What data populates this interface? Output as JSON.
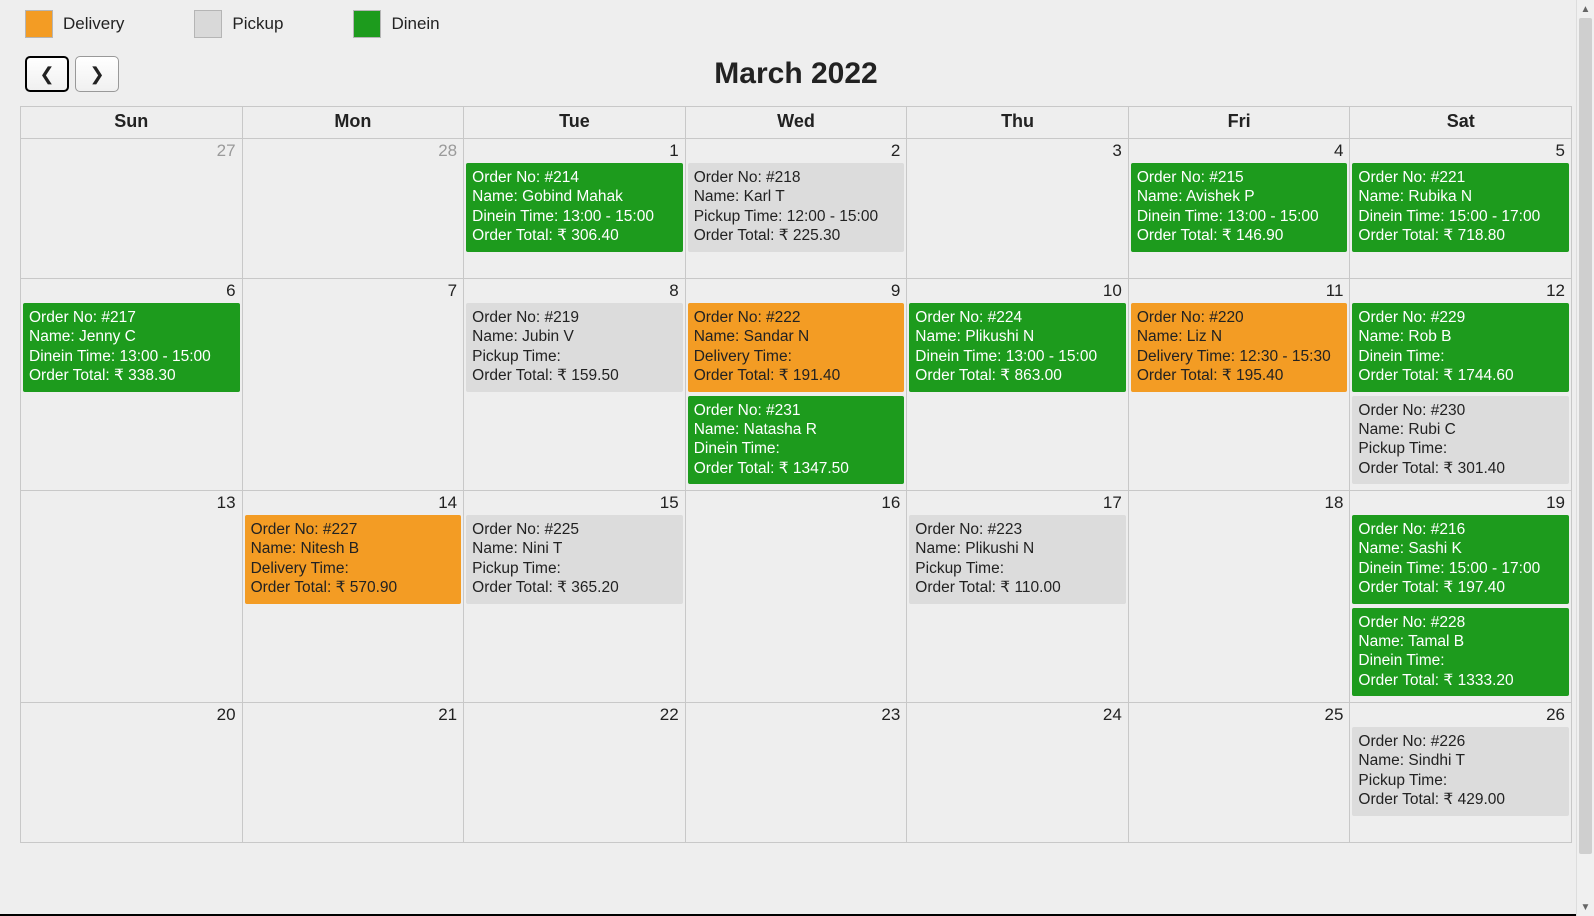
{
  "legend": {
    "delivery": "Delivery",
    "pickup": "Pickup",
    "dinein": "Dinein"
  },
  "nav": {
    "prev_glyph": "❮",
    "next_glyph": "❯"
  },
  "title": "March 2022",
  "weekdays": [
    "Sun",
    "Mon",
    "Tue",
    "Wed",
    "Thu",
    "Fri",
    "Sat"
  ],
  "labels": {
    "order_no": "Order No:",
    "name": "Name:",
    "pickup_time": "Pickup Time:",
    "delivery_time": "Delivery Time:",
    "dinein_time": "Dinein Time:",
    "order_total": "Order Total:"
  },
  "cells": [
    {
      "num": "27",
      "other": true,
      "events": []
    },
    {
      "num": "28",
      "other": true,
      "events": []
    },
    {
      "num": "1",
      "events": [
        {
          "type": "dinein",
          "order_no": "#214",
          "name": "Gobind Mahak",
          "time": "13:00 - 15:00",
          "total": "₹ 306.40"
        }
      ]
    },
    {
      "num": "2",
      "events": [
        {
          "type": "pickup",
          "order_no": "#218",
          "name": "Karl T",
          "time": "12:00 - 15:00",
          "total": "₹ 225.30"
        }
      ]
    },
    {
      "num": "3",
      "events": []
    },
    {
      "num": "4",
      "events": [
        {
          "type": "dinein",
          "order_no": "#215",
          "name": "Avishek P",
          "time": "13:00 - 15:00",
          "total": "₹ 146.90"
        }
      ]
    },
    {
      "num": "5",
      "events": [
        {
          "type": "dinein",
          "order_no": "#221",
          "name": "Rubika N",
          "time": "15:00 - 17:00",
          "total": "₹ 718.80"
        }
      ]
    },
    {
      "num": "6",
      "events": [
        {
          "type": "dinein",
          "order_no": "#217",
          "name": "Jenny C",
          "time": "13:00 - 15:00",
          "total": "₹ 338.30"
        }
      ]
    },
    {
      "num": "7",
      "events": []
    },
    {
      "num": "8",
      "events": [
        {
          "type": "pickup",
          "order_no": "#219",
          "name": "Jubin V",
          "time": "",
          "total": "₹ 159.50"
        }
      ]
    },
    {
      "num": "9",
      "events": [
        {
          "type": "delivery",
          "order_no": "#222",
          "name": "Sandar N",
          "time": "",
          "total": "₹ 191.40"
        },
        {
          "type": "dinein",
          "order_no": "#231",
          "name": "Natasha R",
          "time": "",
          "total": "₹ 1347.50"
        }
      ]
    },
    {
      "num": "10",
      "events": [
        {
          "type": "dinein",
          "order_no": "#224",
          "name": "Plikushi N",
          "time": "13:00 - 15:00",
          "total": "₹ 863.00"
        }
      ]
    },
    {
      "num": "11",
      "events": [
        {
          "type": "delivery",
          "order_no": "#220",
          "name": "Liz N",
          "time": "12:30 - 15:30",
          "total": "₹ 195.40"
        }
      ]
    },
    {
      "num": "12",
      "events": [
        {
          "type": "dinein",
          "order_no": "#229",
          "name": "Rob B",
          "time": "",
          "total": "₹ 1744.60"
        },
        {
          "type": "pickup",
          "order_no": "#230",
          "name": "Rubi C",
          "time": "",
          "total": "₹ 301.40"
        }
      ]
    },
    {
      "num": "13",
      "events": []
    },
    {
      "num": "14",
      "events": [
        {
          "type": "delivery",
          "order_no": "#227",
          "name": "Nitesh B",
          "time": "",
          "total": "₹ 570.90"
        }
      ]
    },
    {
      "num": "15",
      "events": [
        {
          "type": "pickup",
          "order_no": "#225",
          "name": "Nini T",
          "time": "",
          "total": "₹ 365.20"
        }
      ]
    },
    {
      "num": "16",
      "events": []
    },
    {
      "num": "17",
      "events": [
        {
          "type": "pickup",
          "order_no": "#223",
          "name": "Plikushi N",
          "time": "",
          "total": "₹ 110.00"
        }
      ]
    },
    {
      "num": "18",
      "events": []
    },
    {
      "num": "19",
      "events": [
        {
          "type": "dinein",
          "order_no": "#216",
          "name": "Sashi K",
          "time": "15:00 - 17:00",
          "total": "₹ 197.40"
        },
        {
          "type": "dinein",
          "order_no": "#228",
          "name": "Tamal B",
          "time": "",
          "total": "₹ 1333.20"
        }
      ]
    },
    {
      "num": "20",
      "events": []
    },
    {
      "num": "21",
      "events": []
    },
    {
      "num": "22",
      "events": []
    },
    {
      "num": "23",
      "events": []
    },
    {
      "num": "24",
      "events": []
    },
    {
      "num": "25",
      "events": []
    },
    {
      "num": "26",
      "events": [
        {
          "type": "pickup",
          "order_no": "#226",
          "name": "Sindhi T",
          "time": "",
          "total": "₹ 429.00"
        }
      ]
    }
  ]
}
